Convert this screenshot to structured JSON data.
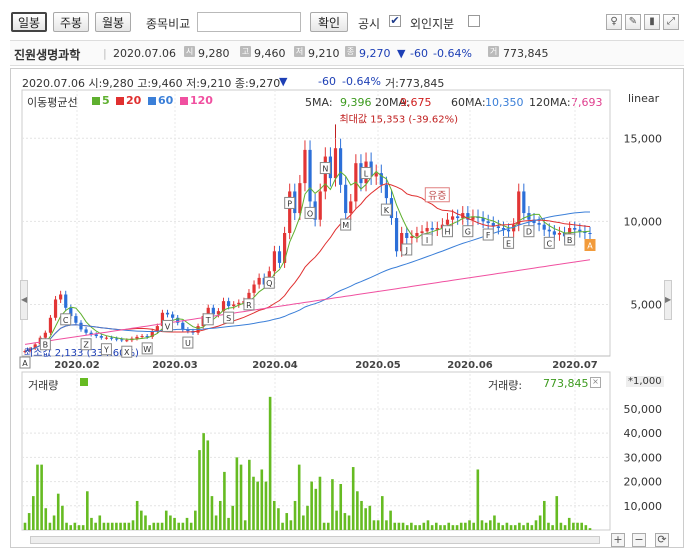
{
  "toolbar": {
    "period_tabs": [
      "일봉",
      "주봉",
      "월봉"
    ],
    "compare_label": "종목비교",
    "compare_placeholder": "",
    "confirm_label": "확인",
    "disclosure_label": "공시",
    "disclosure_checked": "✔",
    "foreign_label": "외인지분",
    "tool_icons": [
      "pin-icon",
      "pencil-icon",
      "column-toggle-icon",
      "expand-icon"
    ]
  },
  "stock": {
    "name": "진원생명과학",
    "date": "2020.07.06",
    "open": "9,280",
    "high": "9,460",
    "low": "9,210",
    "close": "9,270",
    "change_arrow": "▼",
    "change": "-60",
    "change_pct": "-0.64%",
    "volume": "773,845",
    "info_icons": [
      "시",
      "고",
      "저",
      "종",
      "거"
    ]
  },
  "chart_info": {
    "ohlc_line": "2020.07.06 시:9,280 고:9,460 저:9,210 종:9,270",
    "arrow": "▼",
    "change": "-60",
    "change_pct": "-0.64%",
    "vol_text": "거:773,845",
    "scale_label": "linear",
    "ma_title": "이동평균선",
    "ma_items": [
      {
        "label": "5",
        "color": "#5fb02f"
      },
      {
        "label": "20",
        "color": "#e03030"
      },
      {
        "label": "60",
        "color": "#3b7fd8"
      },
      {
        "label": "120",
        "color": "#f050a0"
      }
    ],
    "ma_values": [
      {
        "label": "5MA:",
        "value": "9,396",
        "color": "#3c9a1e"
      },
      {
        "label": "20MA:",
        "value": "9,675",
        "color": "#d02020"
      },
      {
        "label": "60MA:",
        "value": "10,350",
        "color": "#3b7fd8"
      },
      {
        "label": "120MA:",
        "value": "7,693",
        "color": "#e0408f"
      }
    ],
    "max_annotation": "최대값 15,353 (-39.62%)",
    "min_annotation": "최소값 2,133 (334.60%)",
    "event_label": "유증",
    "volume_title": "거래량",
    "volume_label": "거래량:",
    "volume_value": "773,845",
    "volume_scale": "*1,000",
    "colors": {
      "up": "#e23535",
      "down": "#2c6fd8",
      "volume": "#66bb22",
      "ma5": "#5fb02f",
      "ma20": "#e03030",
      "ma60": "#3b7fd8",
      "ma120": "#f050a0"
    }
  },
  "chart_data": [
    {
      "type": "candlestick",
      "title": "",
      "scale": "linear",
      "yticks": [
        5000,
        10000,
        15000
      ],
      "ytick_labels": [
        "5,000",
        "10,000",
        "15,000"
      ],
      "ylim": [
        1900,
        16700
      ],
      "xtick_labels": [
        "2020.02",
        "2020.03",
        "2020.04",
        "2020.05",
        "2020.06",
        "2020.07"
      ],
      "x_start": "2020-01-16",
      "x_end": "2020-07-06",
      "candles_close": [
        2200,
        2350,
        2600,
        3000,
        3300,
        4200,
        5300,
        5600,
        4800,
        4300,
        3900,
        3500,
        3300,
        3200,
        3100,
        3000,
        3000,
        2950,
        2900,
        2850,
        2850,
        2950,
        3050,
        3100,
        3050,
        3400,
        3700,
        4500,
        4400,
        4200,
        3900,
        3500,
        3400,
        3300,
        3700,
        4300,
        4800,
        4400,
        4600,
        5200,
        4900,
        5000,
        5100,
        5200,
        5700,
        6200,
        6600,
        6200,
        7000,
        8200,
        7500,
        9300,
        11800,
        10500,
        12300,
        14300,
        11200,
        10100,
        11800,
        13900,
        12600,
        14400,
        12200,
        10500,
        11200,
        13500,
        12300,
        13600,
        12700,
        12900,
        12200,
        11400,
        10200,
        8200,
        9300,
        9000,
        9100,
        9300,
        9400,
        9600,
        9500,
        9600,
        9800,
        10100,
        10300,
        10200,
        10500,
        10100,
        10300,
        10200,
        10000,
        9900,
        9700,
        9600,
        9500,
        9400,
        9800,
        11800,
        10500,
        10100,
        9900,
        9800,
        9500,
        9400,
        9200,
        9300,
        9100,
        9600,
        9500,
        9400,
        9300,
        9270
      ],
      "markers": [
        "A",
        "B",
        "C",
        "Z",
        "Y",
        "X",
        "W",
        "V",
        "U",
        "T",
        "S",
        "R",
        "Q",
        "P",
        "O",
        "N",
        "M",
        "L",
        "K",
        "J",
        "I",
        "H",
        "G",
        "F",
        "E",
        "D",
        "C",
        "B",
        "A"
      ],
      "ma_series": [
        "5",
        "20",
        "60",
        "120"
      ]
    },
    {
      "type": "bar",
      "title": "",
      "ylabel": "",
      "yticks": [
        10000,
        20000,
        30000,
        40000,
        50000
      ],
      "ytick_labels": [
        "10,000",
        "20,000",
        "30,000",
        "40,000",
        "50,000"
      ],
      "ylim": [
        0,
        57000
      ],
      "values": [
        3000,
        7000,
        14000,
        27000,
        27000,
        9000,
        3000,
        6000,
        15000,
        10000,
        3000,
        2000,
        3000,
        2000,
        2000,
        16000,
        5000,
        3000,
        6000,
        3000,
        3000,
        3000,
        3000,
        3000,
        3000,
        3000,
        4000,
        12000,
        8000,
        6000,
        2000,
        3000,
        3000,
        3000,
        8000,
        6000,
        5000,
        3000,
        3000,
        5000,
        3000,
        8000,
        33000,
        40000,
        37000,
        14000,
        6000,
        12000,
        24000,
        5000,
        10000,
        30000,
        27000,
        4000,
        29000,
        22000,
        20000,
        25000,
        20000,
        55000,
        12000,
        9000,
        3000,
        7000,
        4000,
        12000,
        27000,
        6000,
        10000,
        20000,
        17000,
        22000,
        3000,
        3000,
        21000,
        8000,
        19000,
        7000,
        6000,
        26000,
        16000,
        12000,
        9000,
        10000,
        4000,
        4000,
        14000,
        4000,
        8000,
        3000,
        3000,
        3000,
        2000,
        3000,
        2000,
        2000,
        3000,
        4000,
        2000,
        3000,
        2000,
        2000,
        3000,
        2000,
        2000,
        3000,
        3000,
        4000,
        3000,
        25000,
        4000,
        3000,
        4000,
        6000,
        3000,
        2000,
        3000,
        2000,
        2000,
        3000,
        2000,
        3000,
        2000,
        4000,
        6000,
        12000,
        3000,
        2000,
        14000,
        3000,
        2000,
        5000,
        3000,
        3000,
        3000,
        2000,
        773
      ]
    }
  ]
}
